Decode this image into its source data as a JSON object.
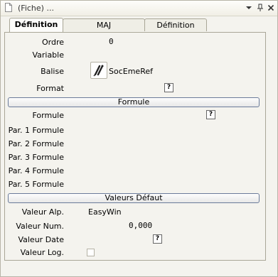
{
  "window": {
    "title": "(Fiche) ..."
  },
  "tabs": [
    {
      "label": "Définition"
    },
    {
      "label": "MAJ Complémentaires"
    },
    {
      "label": "Définition Balise"
    }
  ],
  "fields": {
    "ordre": {
      "label": "Ordre",
      "value": "0"
    },
    "variable": {
      "label": "Variable",
      "value": ""
    },
    "balise": {
      "label": "Balise",
      "value": "SocEmeRef",
      "icon": "balise-pick-icon"
    },
    "format": {
      "label": "Format",
      "help": "?"
    }
  },
  "sections": {
    "formule": "Formule",
    "valeurs_defaut": "Valeurs Défaut"
  },
  "formula_fields": {
    "formule": {
      "label": "Formule",
      "help": "?"
    },
    "par1": {
      "label": "Par. 1 Formule"
    },
    "par2": {
      "label": "Par. 2 Formule"
    },
    "par3": {
      "label": "Par. 3 Formule"
    },
    "par4": {
      "label": "Par. 4 Formule"
    },
    "par5": {
      "label": "Par. 5 Formule"
    }
  },
  "defaults": {
    "alp": {
      "label": "Valeur Alp.",
      "value": "EasyWin"
    },
    "num": {
      "label": "Valeur Num.",
      "value": "0,000"
    },
    "date": {
      "label": "Valeur Date",
      "help": "?"
    },
    "log": {
      "label": "Valeur Log.",
      "checked": false
    }
  }
}
